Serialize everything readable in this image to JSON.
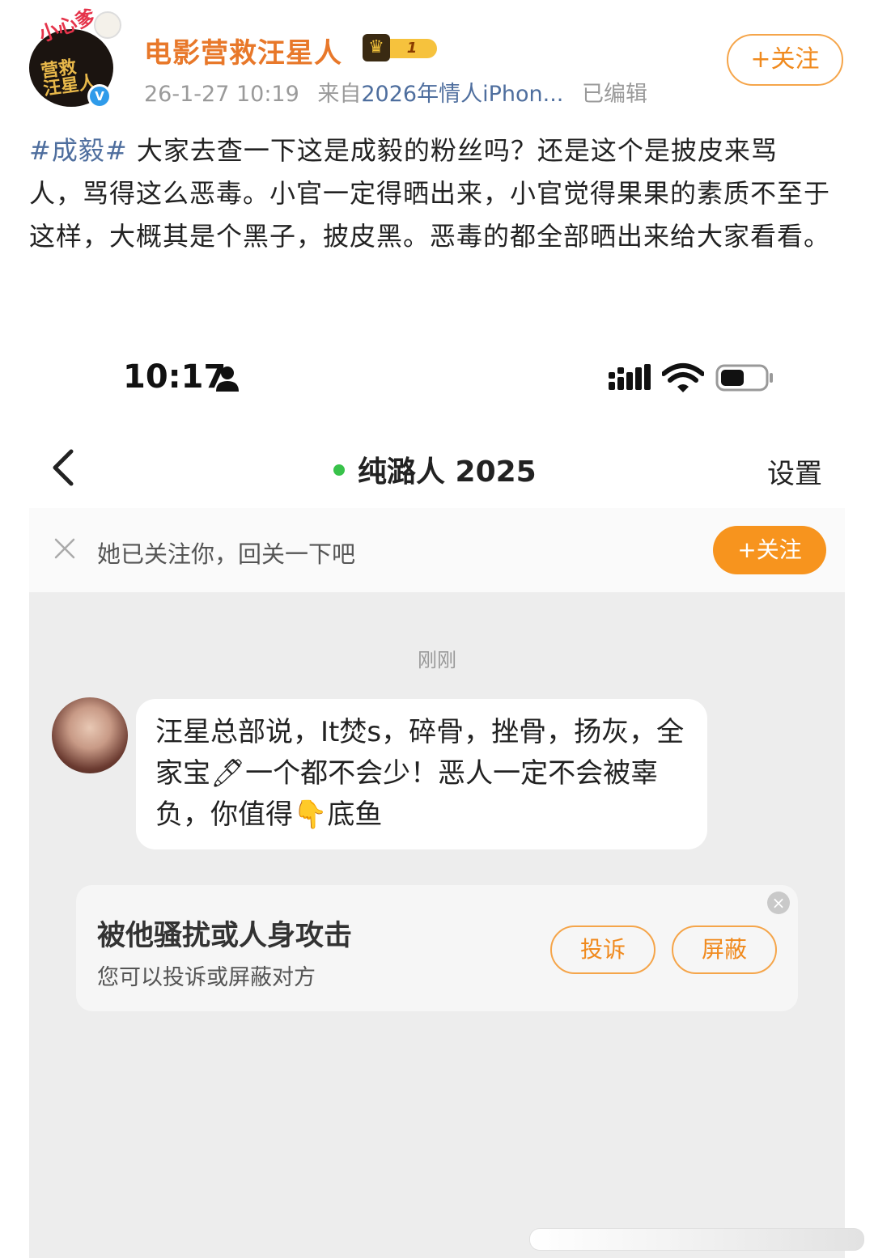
{
  "post": {
    "author": "电影营救汪星人",
    "badge_level": "1",
    "avatar_text_top": "小心爹",
    "avatar_text_main": "营救汪星人",
    "date": "26-1-27 10:19",
    "source_prefix": "来自",
    "source": "2026年情人iPhon...",
    "edited": "已编辑",
    "follow_label": "+关注",
    "hashtag": "#成毅#",
    "body": " 大家去查一下这是成毅的粉丝吗？还是这个是披皮来骂人，骂得这么恶毒。小官一定得晒出来，小官觉得果果的素质不至于这样，大概其是个黑子，披皮黑。恶毒的都全部晒出来给大家看看。"
  },
  "screenshot": {
    "status_time": "10:17",
    "chat_title": "纯潞人 2025",
    "settings_label": "设置",
    "banner_text": "她已关注你，回关一下吧",
    "banner_follow_label": "+关注",
    "timestamp": "刚刚",
    "message": "汪星总部说，It焚s，碎骨，挫骨，扬灰，全家宝🖊一个都不会少！恶人一定不会被辜负，你值得👇底鱼",
    "report_title": "被他骚扰或人身攻击",
    "report_subtitle": "您可以投诉或屏蔽对方",
    "complain_label": "投诉",
    "block_label": "屏蔽"
  },
  "colors": {
    "accent_orange": "#f7941e",
    "link_blue": "#4e6e9e",
    "online_green": "#38c24a"
  }
}
